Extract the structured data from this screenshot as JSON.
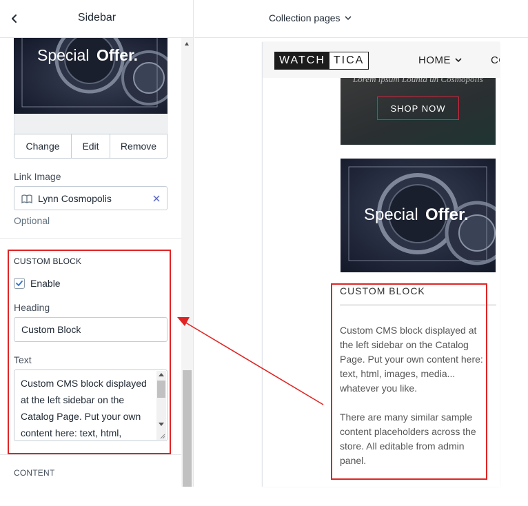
{
  "panel": {
    "title": "Sidebar",
    "image_actions": {
      "change": "Change",
      "edit": "Edit",
      "remove": "Remove"
    },
    "image_banner": {
      "word1": "Special",
      "word2": "Offer."
    },
    "link_image": {
      "label": "Link Image",
      "value": "Lynn Cosmopolis",
      "help": "Optional"
    },
    "custom_block": {
      "title": "CUSTOM BLOCK",
      "enable_label": "Enable",
      "enabled": true,
      "heading_label": "Heading",
      "heading_value": "Custom Block",
      "text_label": "Text",
      "text_value": "Custom CMS block displayed at the left sidebar on the Catalog Page. Put your own content here: text, html,"
    },
    "next_section": "CONTENT"
  },
  "topbar": {
    "page_select": "Collection pages"
  },
  "preview": {
    "logo_left": "WATCH",
    "logo_right": "TICA",
    "nav": {
      "home": "HOME",
      "next": "CO"
    },
    "banner1_faint": "Lorem ipsum Lounta un Cosmopolis",
    "shop_button": "SHOP NOW",
    "banner2": {
      "word1": "Special",
      "word2": "Offer."
    },
    "custom_block": {
      "title": "CUSTOM BLOCK",
      "para1": "Custom CMS block displayed at the left sidebar on the Catalog Page. Put your own content here: text, html, images, media... whatever you like.",
      "para2": "There are many similar sample content placeholders across the store. All editable from admin panel."
    }
  },
  "colors": {
    "highlight": "#e02424",
    "accent_check": "#2c6ecb",
    "shop_border": "#d7263d"
  },
  "icons": {
    "back": "chevron-left-icon",
    "page_dropdown": "chevron-down-icon",
    "link_doc": "document-icon",
    "clear": "close-icon",
    "checkbox": "checkmark-icon"
  }
}
